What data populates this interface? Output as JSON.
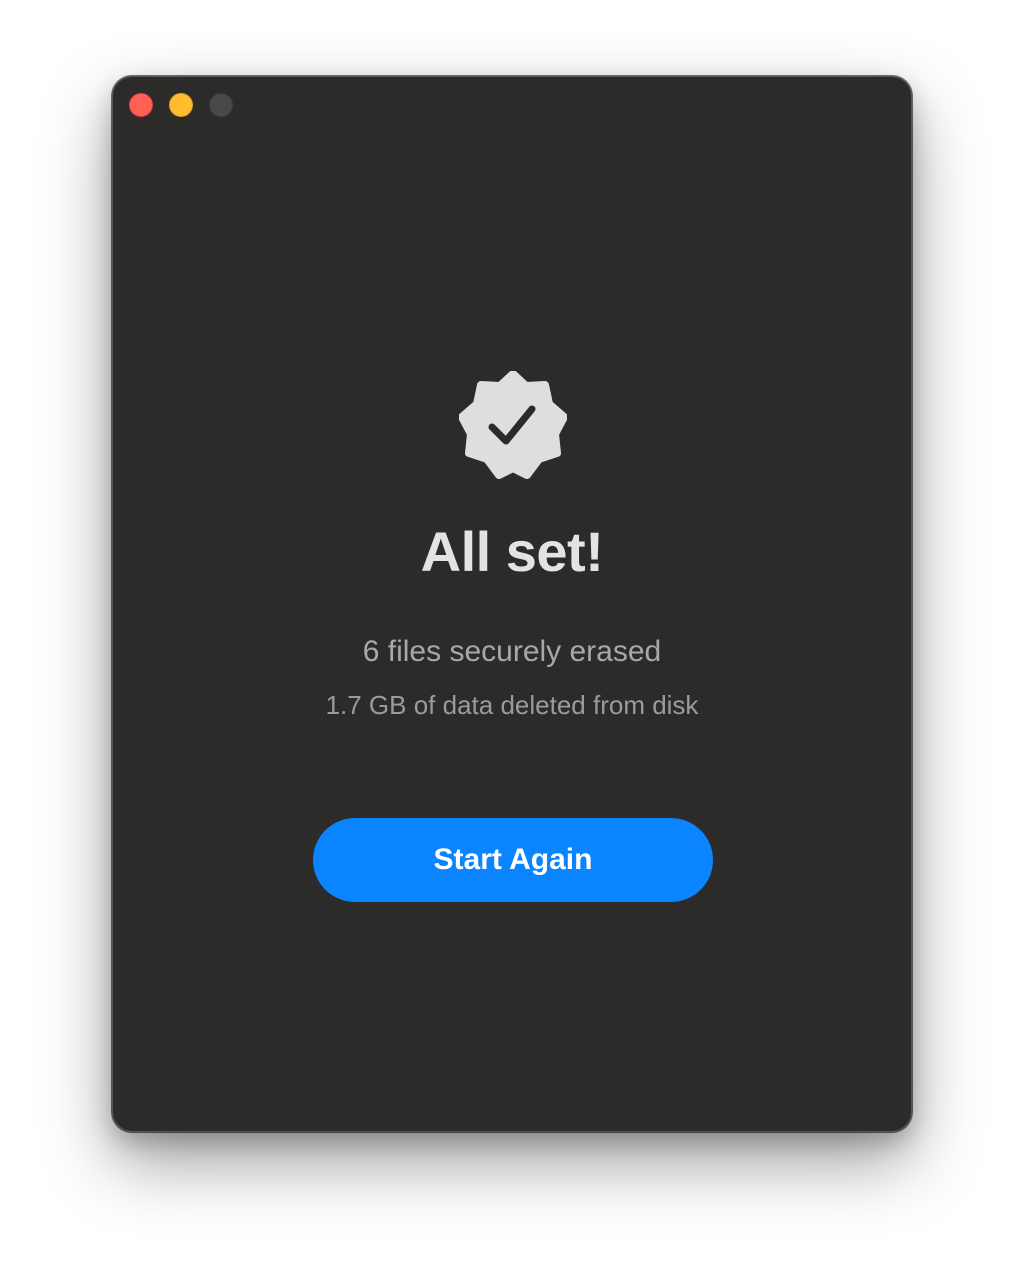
{
  "window": {
    "traffic_lights": [
      {
        "name": "close",
        "color": "#fe5f57"
      },
      {
        "name": "minimize",
        "color": "#febc2e"
      },
      {
        "name": "zoom",
        "color": "#4a4948"
      }
    ],
    "background": "#2c2b2a"
  },
  "result": {
    "icon": "checkmark-seal-icon",
    "title": "All set!",
    "summary": "6 files securely erased",
    "detail": "1.7 GB of data deleted from disk"
  },
  "actions": {
    "start_again_label": "Start Again",
    "accent": "#0a84ff"
  }
}
